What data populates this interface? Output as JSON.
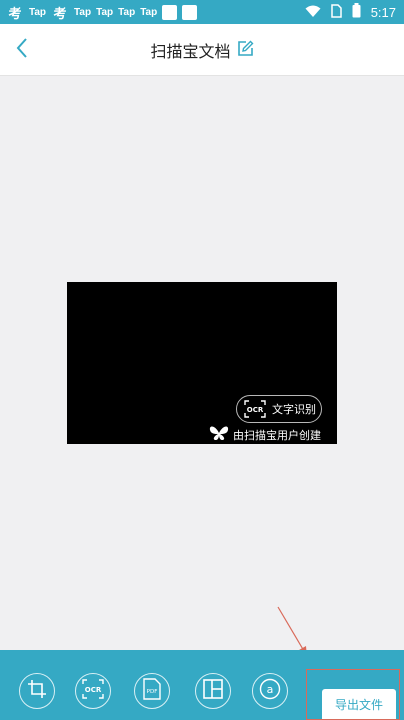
{
  "status_bar": {
    "app_labels": [
      "Tap",
      "Tap",
      "Tap",
      "Tap",
      "Tap"
    ],
    "kanji_glyph": "考",
    "time": "5:17",
    "icons": [
      "wifi-icon",
      "sim-icon",
      "battery-icon"
    ]
  },
  "header": {
    "title": "扫描宝文档",
    "back_icon": "chevron-left-icon",
    "edit_icon": "edit-icon"
  },
  "document": {
    "ocr_label": "文字识别",
    "ocr_icon_text": "OCR",
    "watermark": "由扫描宝用户创建"
  },
  "toolbar": {
    "tools": [
      "crop-icon",
      "ocr-icon",
      "pdf-icon",
      "layout-icon",
      "text-icon"
    ],
    "ocr_icon_text": "OCR",
    "pdf_icon_text": "PDF",
    "text_icon_glyph": "a",
    "export_label": "导出文件"
  },
  "colors": {
    "accent": "#35a9c4",
    "annotation": "#d96a5a"
  }
}
